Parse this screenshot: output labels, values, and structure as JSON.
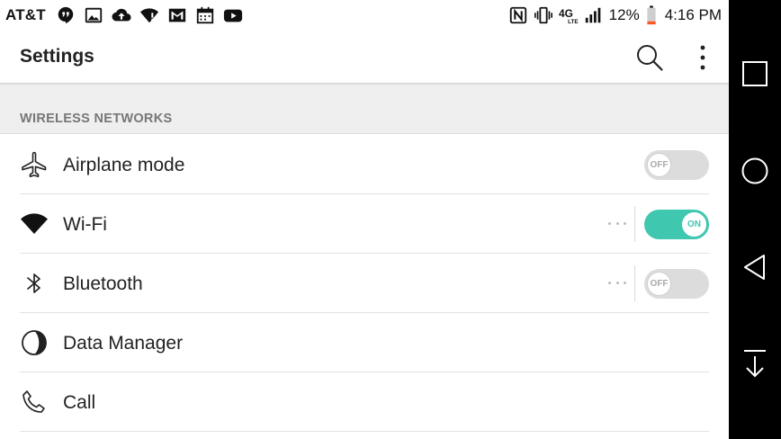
{
  "status_bar": {
    "carrier": "AT&T",
    "left_icons": [
      "hangouts-icon",
      "gallery-icon",
      "cloud-upload-icon",
      "wifi-alert-icon",
      "gmail-icon",
      "calendar-icon",
      "youtube-icon"
    ],
    "right_icons": [
      "nfc-icon",
      "vibrate-icon",
      "lte-icon",
      "signal-icon"
    ],
    "battery_percent": "12%",
    "battery_level": 0.12,
    "battery_color": "#ff5722",
    "time": "4:16 PM"
  },
  "app_bar": {
    "title": "Settings",
    "actions": [
      "search-icon",
      "more-vert-icon"
    ]
  },
  "section": {
    "title": "WIRELESS NETWORKS"
  },
  "items": [
    {
      "label": "Airplane mode",
      "icon": "airplane-icon",
      "toggle": "OFF",
      "has_more": false
    },
    {
      "label": "Wi-Fi",
      "icon": "wifi-icon",
      "toggle": "ON",
      "has_more": true
    },
    {
      "label": "Bluetooth",
      "icon": "bluetooth-icon",
      "toggle": "OFF",
      "has_more": true
    },
    {
      "label": "Data Manager",
      "icon": "data-usage-icon",
      "toggle": null,
      "has_more": false
    },
    {
      "label": "Call",
      "icon": "phone-icon",
      "toggle": null,
      "has_more": false
    }
  ],
  "nav_bar": {
    "buttons": [
      "recents-icon",
      "home-icon",
      "back-icon",
      "notifications-down-icon"
    ]
  },
  "colors": {
    "accent": "#3fc7b0",
    "section_bg": "#efeff0",
    "nav_bg": "#000000"
  }
}
